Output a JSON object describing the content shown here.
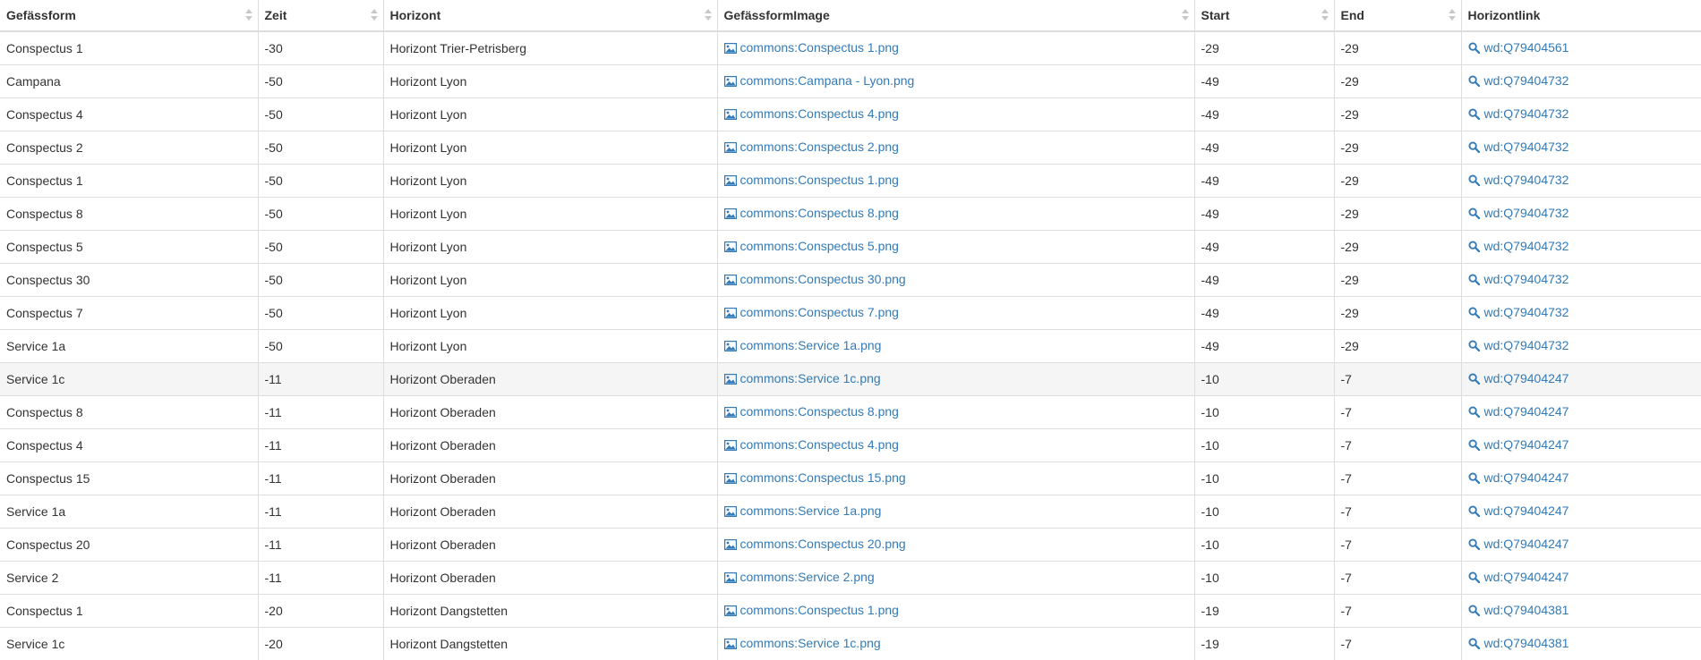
{
  "columns": [
    "Gefässform",
    "Zeit",
    "Horizont",
    "GefässformImage",
    "Start",
    "End",
    "Horizontlink"
  ],
  "icons": {
    "image": "image-icon",
    "link": "search-icon"
  },
  "colors": {
    "link": "#337ab7",
    "hover_row": "#f5f5f5",
    "border": "#dddddd"
  },
  "rows": [
    {
      "form": "Conspectus 1",
      "zeit": "-30",
      "horizont": "Horizont Trier-Petrisberg",
      "image": "commons:Conspectus 1.png",
      "start": "-29",
      "end": "-29",
      "link": "wd:Q79404561"
    },
    {
      "form": "Campana",
      "zeit": "-50",
      "horizont": "Horizont Lyon",
      "image": "commons:Campana - Lyon.png",
      "start": "-49",
      "end": "-29",
      "link": "wd:Q79404732"
    },
    {
      "form": "Conspectus 4",
      "zeit": "-50",
      "horizont": "Horizont Lyon",
      "image": "commons:Conspectus 4.png",
      "start": "-49",
      "end": "-29",
      "link": "wd:Q79404732"
    },
    {
      "form": "Conspectus 2",
      "zeit": "-50",
      "horizont": "Horizont Lyon",
      "image": "commons:Conspectus 2.png",
      "start": "-49",
      "end": "-29",
      "link": "wd:Q79404732"
    },
    {
      "form": "Conspectus 1",
      "zeit": "-50",
      "horizont": "Horizont Lyon",
      "image": "commons:Conspectus 1.png",
      "start": "-49",
      "end": "-29",
      "link": "wd:Q79404732"
    },
    {
      "form": "Conspectus 8",
      "zeit": "-50",
      "horizont": "Horizont Lyon",
      "image": "commons:Conspectus 8.png",
      "start": "-49",
      "end": "-29",
      "link": "wd:Q79404732"
    },
    {
      "form": "Conspectus 5",
      "zeit": "-50",
      "horizont": "Horizont Lyon",
      "image": "commons:Conspectus 5.png",
      "start": "-49",
      "end": "-29",
      "link": "wd:Q79404732"
    },
    {
      "form": "Conspectus 30",
      "zeit": "-50",
      "horizont": "Horizont Lyon",
      "image": "commons:Conspectus 30.png",
      "start": "-49",
      "end": "-29",
      "link": "wd:Q79404732"
    },
    {
      "form": "Conspectus 7",
      "zeit": "-50",
      "horizont": "Horizont Lyon",
      "image": "commons:Conspectus 7.png",
      "start": "-49",
      "end": "-29",
      "link": "wd:Q79404732"
    },
    {
      "form": "Service 1a",
      "zeit": "-50",
      "horizont": "Horizont Lyon",
      "image": "commons:Service 1a.png",
      "start": "-49",
      "end": "-29",
      "link": "wd:Q79404732"
    },
    {
      "form": "Service 1c",
      "zeit": "-11",
      "horizont": "Horizont Oberaden",
      "image": "commons:Service 1c.png",
      "start": "-10",
      "end": "-7",
      "link": "wd:Q79404247"
    },
    {
      "form": "Conspectus 8",
      "zeit": "-11",
      "horizont": "Horizont Oberaden",
      "image": "commons:Conspectus 8.png",
      "start": "-10",
      "end": "-7",
      "link": "wd:Q79404247"
    },
    {
      "form": "Conspectus 4",
      "zeit": "-11",
      "horizont": "Horizont Oberaden",
      "image": "commons:Conspectus 4.png",
      "start": "-10",
      "end": "-7",
      "link": "wd:Q79404247"
    },
    {
      "form": "Conspectus 15",
      "zeit": "-11",
      "horizont": "Horizont Oberaden",
      "image": "commons:Conspectus 15.png",
      "start": "-10",
      "end": "-7",
      "link": "wd:Q79404247"
    },
    {
      "form": "Service 1a",
      "zeit": "-11",
      "horizont": "Horizont Oberaden",
      "image": "commons:Service 1a.png",
      "start": "-10",
      "end": "-7",
      "link": "wd:Q79404247"
    },
    {
      "form": "Conspectus 20",
      "zeit": "-11",
      "horizont": "Horizont Oberaden",
      "image": "commons:Conspectus 20.png",
      "start": "-10",
      "end": "-7",
      "link": "wd:Q79404247"
    },
    {
      "form": "Service 2",
      "zeit": "-11",
      "horizont": "Horizont Oberaden",
      "image": "commons:Service 2.png",
      "start": "-10",
      "end": "-7",
      "link": "wd:Q79404247"
    },
    {
      "form": "Conspectus 1",
      "zeit": "-20",
      "horizont": "Horizont Dangstetten",
      "image": "commons:Conspectus 1.png",
      "start": "-19",
      "end": "-7",
      "link": "wd:Q79404381"
    },
    {
      "form": "Service 1c",
      "zeit": "-20",
      "horizont": "Horizont Dangstetten",
      "image": "commons:Service 1c.png",
      "start": "-19",
      "end": "-7",
      "link": "wd:Q79404381"
    }
  ]
}
